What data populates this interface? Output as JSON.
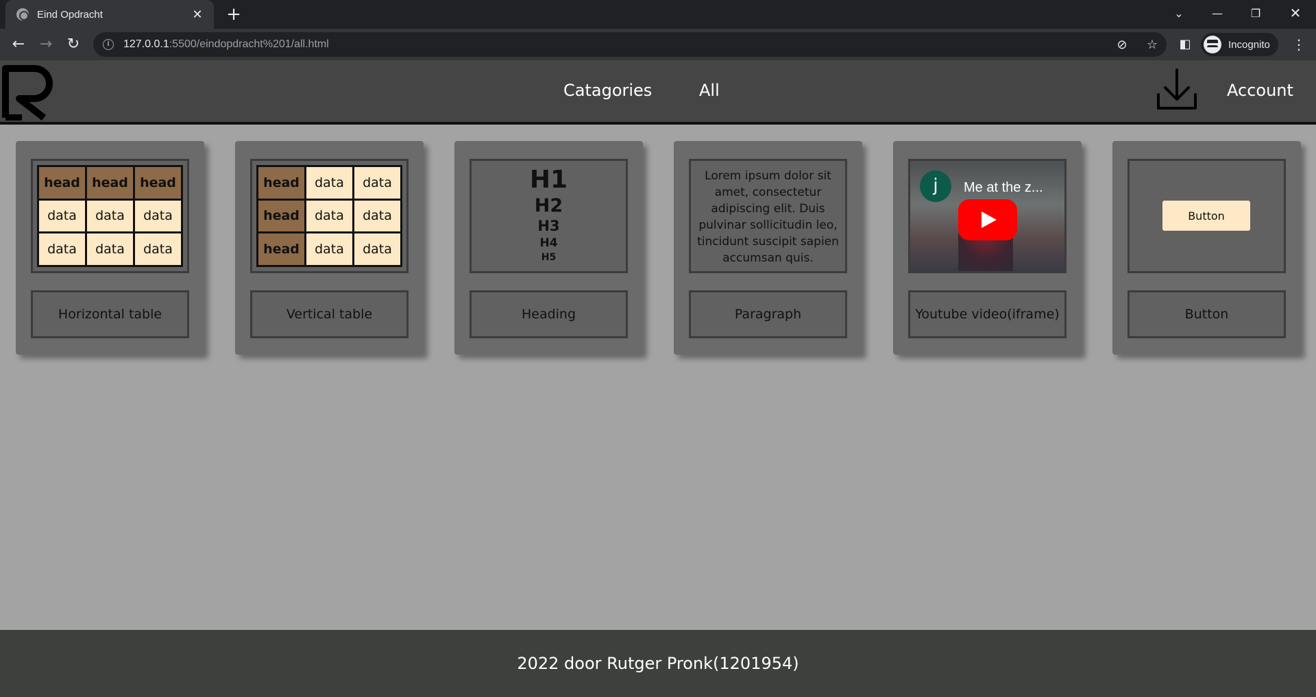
{
  "browser": {
    "tab_title": "Eind Opdracht",
    "url_host": "127.0.0.1",
    "url_path": ":5500/eindopdracht%201/all.html",
    "profile_label": "Incognito"
  },
  "header": {
    "nav": [
      {
        "label": "Catagories"
      },
      {
        "label": "All"
      }
    ],
    "account_label": "Account"
  },
  "cards": {
    "horizontal_table": {
      "label": "Horizontal table",
      "rows": [
        [
          "head",
          "head",
          "head"
        ],
        [
          "data",
          "data",
          "data"
        ],
        [
          "data",
          "data",
          "data"
        ]
      ]
    },
    "vertical_table": {
      "label": "Vertical table",
      "rows": [
        [
          "head",
          "data",
          "data"
        ],
        [
          "head",
          "data",
          "data"
        ],
        [
          "head",
          "data",
          "data"
        ]
      ]
    },
    "heading": {
      "label": "Heading",
      "levels": [
        "H1",
        "H2",
        "H3",
        "H4",
        "H5"
      ]
    },
    "paragraph": {
      "label": "Paragraph",
      "text": "Lorem ipsum dolor sit amet, consectetur adipiscing elit. Duis pulvinar sollicitudin leo, tincidunt suscipit sapien accumsan quis."
    },
    "youtube": {
      "label": "Youtube video(iframe)",
      "channel_initial": "j",
      "video_title": "Me at the z..."
    },
    "button": {
      "label": "Button",
      "button_text": "Button"
    }
  },
  "footer": {
    "text": "2022 door Rutger Pronk(1201954)"
  },
  "colors": {
    "page_bg": "#a3a3a3",
    "header_bg": "#454545",
    "card_bg": "#6b6b6b",
    "table_head": "#8d6a48",
    "table_data": "#fde9c5",
    "footer_bg": "#3e403e",
    "youtube_red": "#ff0000"
  }
}
